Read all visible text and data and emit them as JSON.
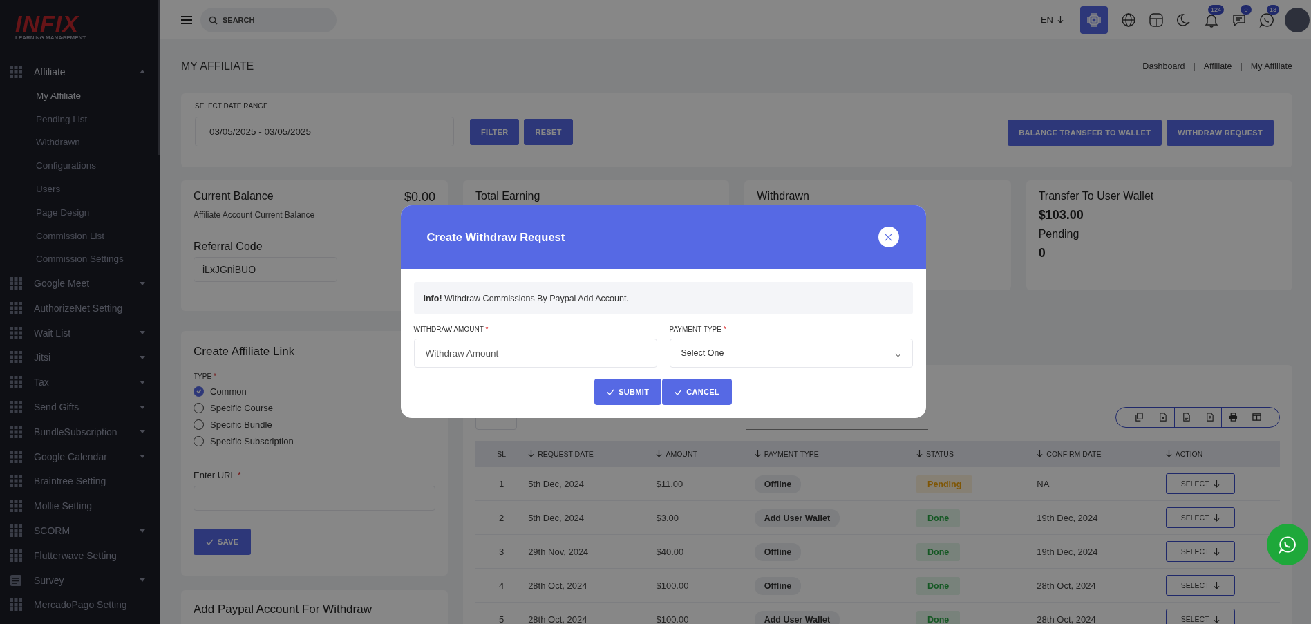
{
  "sidebar": {
    "logo": {
      "title": "INFIX",
      "subtitle": "LEARNING MANAGEMENT"
    },
    "items": [
      {
        "label": "Affiliate",
        "kind": "grid",
        "expanded": true,
        "children": [
          {
            "label": "My Affiliate",
            "selected": true
          },
          {
            "label": "Pending List",
            "selected": false
          },
          {
            "label": "Withdrawn",
            "selected": false
          },
          {
            "label": "Configurations",
            "selected": false
          },
          {
            "label": "Users",
            "selected": false
          },
          {
            "label": "Page Design",
            "selected": false
          },
          {
            "label": "Commission List",
            "selected": false
          },
          {
            "label": "Commission Settings",
            "selected": false
          }
        ]
      },
      {
        "label": "Google Meet",
        "kind": "grid",
        "expanded": false
      },
      {
        "label": "AuthorizeNet Setting",
        "kind": "grid"
      },
      {
        "label": "Wait List",
        "kind": "grid",
        "expanded": false
      },
      {
        "label": "Jitsi",
        "kind": "grid",
        "expanded": false
      },
      {
        "label": "Tax",
        "kind": "grid",
        "expanded": false
      },
      {
        "label": "Send Gifts",
        "kind": "grid",
        "expanded": false
      },
      {
        "label": "BundleSubscription",
        "kind": "grid",
        "expanded": false
      },
      {
        "label": "Google Calendar",
        "kind": "grid",
        "expanded": false
      },
      {
        "label": "Braintree Setting",
        "kind": "grid"
      },
      {
        "label": "Mollie Setting",
        "kind": "grid"
      },
      {
        "label": "SCORM",
        "kind": "grid",
        "expanded": false
      },
      {
        "label": "Flutterwave Setting",
        "kind": "grid"
      },
      {
        "label": "Survey",
        "kind": "document",
        "expanded": false
      },
      {
        "label": "MercadoPago Setting",
        "kind": "grid"
      }
    ]
  },
  "header": {
    "search": {
      "placeholder": "SEARCH"
    },
    "language": "EN",
    "icons": [
      {
        "kind": "chip"
      },
      {
        "kind": "globe"
      },
      {
        "kind": "layout"
      },
      {
        "kind": "moon"
      },
      {
        "kind": "bell",
        "badge": "124"
      },
      {
        "kind": "chat",
        "badge": "0"
      },
      {
        "kind": "whatsapp",
        "badge": "13"
      }
    ]
  },
  "page": {
    "title": "MY AFFILIATE",
    "breadcrumb": [
      {
        "kind": "link",
        "text": "Dashboard"
      },
      {
        "kind": "separator",
        "text": "|"
      },
      {
        "kind": "link",
        "text": "Affiliate"
      },
      {
        "kind": "separator",
        "text": "|"
      },
      {
        "kind": "link",
        "text": "My Affiliate"
      }
    ]
  },
  "filter": {
    "label": "SELECT DATE RANGE",
    "value": "03/05/2025 - 03/05/2025",
    "buttons": [
      "FILTER",
      "RESET"
    ],
    "actions": [
      "BALANCE TRANSFER TO WALLET",
      "WITHDRAW REQUEST"
    ]
  },
  "balance_card": {
    "title": "Current Balance",
    "amount": "$0.00",
    "subtitle": "Affiliate Account Current Balance",
    "referral_label": "Referral Code",
    "referral_code": "iLxJGniBUO"
  },
  "stat_cards": [
    {
      "kind": "plain",
      "title": "Total Earning"
    },
    {
      "kind": "plain",
      "title": "Withdrawn"
    },
    {
      "kind": "wallet",
      "title": "Transfer To User Wallet",
      "amount": "$103.00",
      "pending_label": "Pending",
      "pending": "0"
    }
  ],
  "affiliate_link": {
    "title": "Create Affiliate Link",
    "type_label": "TYPE",
    "type_mark": "*",
    "types": [
      {
        "label": "Common",
        "selected": true
      },
      {
        "label": "Specific Course",
        "selected": false
      },
      {
        "label": "Specific Bundle",
        "selected": false
      },
      {
        "label": "Specific Subscription",
        "selected": false
      }
    ],
    "url_label": "Enter URL",
    "url_mark": "*",
    "save": "SAVE"
  },
  "paypal_card": {
    "title": "Add Paypal Account For Withdraw"
  },
  "table": {
    "tools": [
      {
        "kind": "copy"
      },
      {
        "kind": "excel"
      },
      {
        "kind": "csv"
      },
      {
        "kind": "pdf"
      },
      {
        "kind": "print"
      },
      {
        "kind": "columns"
      }
    ],
    "columns": [
      {
        "label": "SL",
        "sortable": false
      },
      {
        "label": "REQUEST DATE",
        "sortable": true
      },
      {
        "label": "AMOUNT",
        "sortable": true
      },
      {
        "label": "PAYMENT TYPE",
        "sortable": true
      },
      {
        "label": "STATUS",
        "sortable": true
      },
      {
        "label": "CONFIRM DATE",
        "sortable": true
      },
      {
        "label": "ACTION",
        "sortable": true
      }
    ],
    "rows": [
      {
        "sl": "1",
        "request_date": "5th Dec, 2024",
        "amount": "$11.00",
        "payment_type": "Offline",
        "status": {
          "label": "Pending",
          "kind": "pending"
        },
        "confirm_date": "NA",
        "action": "SELECT"
      },
      {
        "sl": "2",
        "request_date": "5th Dec, 2024",
        "amount": "$3.00",
        "payment_type": "Add User Wallet",
        "status": {
          "label": "Done",
          "kind": "done"
        },
        "confirm_date": "19th Dec, 2024",
        "action": "SELECT"
      },
      {
        "sl": "3",
        "request_date": "29th Nov, 2024",
        "amount": "$40.00",
        "payment_type": "Offline",
        "status": {
          "label": "Done",
          "kind": "done"
        },
        "confirm_date": "19th Dec, 2024",
        "action": "SELECT"
      },
      {
        "sl": "4",
        "request_date": "28th Oct, 2024",
        "amount": "$100.00",
        "payment_type": "Offline",
        "status": {
          "label": "Done",
          "kind": "done"
        },
        "confirm_date": "28th Oct, 2024",
        "action": "SELECT"
      },
      {
        "sl": "5",
        "request_date": "28th Oct, 2024",
        "amount": "$100.00",
        "payment_type": "Add User Wallet",
        "status": {
          "label": "Done",
          "kind": "done"
        },
        "confirm_date": "28th Oct, 2024",
        "action": "SELECT"
      }
    ]
  },
  "modal": {
    "title": "Create Withdraw Request",
    "info": "**Info!** Withdraw Commissions By Paypal Add Account.",
    "fields": [
      {
        "kind": "input",
        "label": "WITHDRAW AMOUNT",
        "mark": "*",
        "placeholder": "Withdraw Amount"
      },
      {
        "kind": "select",
        "label": "PAYMENT TYPE",
        "mark": "*",
        "value": "Select One"
      }
    ],
    "buttons": [
      "SUBMIT",
      "CANCEL"
    ]
  }
}
